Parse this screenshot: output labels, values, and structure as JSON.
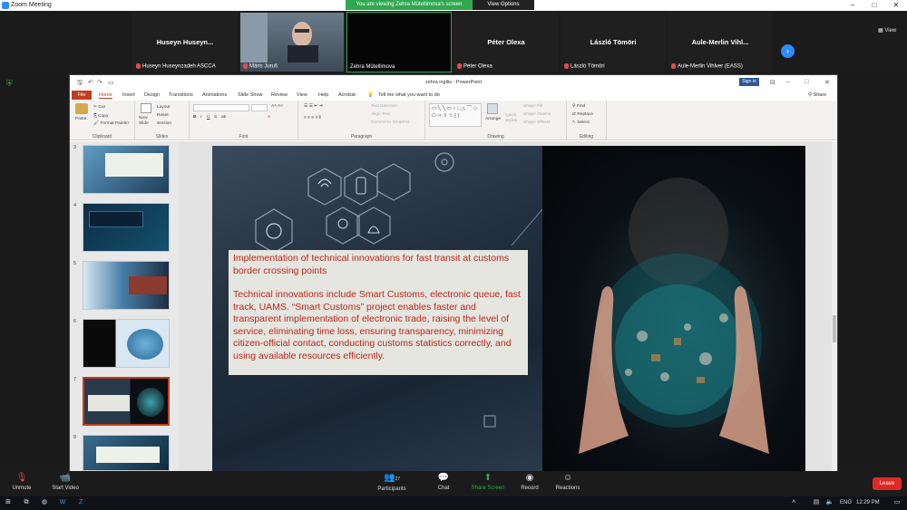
{
  "window": {
    "app_title": "Zoom Meeting"
  },
  "share_banner": {
    "viewing": "You are viewing Zehra Mütellimova's screen",
    "view_options": "View Options"
  },
  "gallery": {
    "view_label": "View",
    "tiles": [
      {
        "big": "Huseyn  Huseyn...",
        "name": "Huseyn Huseynzadeh ASCCA"
      },
      {
        "big": "",
        "name": "Märis Juruš"
      },
      {
        "big": "",
        "name": "Zehra Mütellimova"
      },
      {
        "big": "Péter Olexa",
        "name": "Péter Olexa"
      },
      {
        "big": "László Tömöri",
        "name": "László Tömöri"
      },
      {
        "big": "Aule-Merlin  Vihl...",
        "name": "Aule-Merlin Vihlver (EASS)"
      }
    ]
  },
  "powerpoint": {
    "title": "zehra ingilis  -  PowerPoint",
    "sign_in": "Sign in",
    "share": "Share",
    "tell_me": "Tell me what you want to do",
    "tabs": [
      "File",
      "Home",
      "Insert",
      "Design",
      "Transitions",
      "Animations",
      "Slide Show",
      "Review",
      "View",
      "Help",
      "Acrobat"
    ],
    "ribbon": {
      "clipboard": {
        "label": "Clipboard",
        "paste": "Paste",
        "cut": "Cut",
        "copy": "Copy",
        "format_painter": "Format Painter"
      },
      "slides": {
        "label": "Slides",
        "new_slide": "New Slide",
        "layout": "Layout",
        "reset": "Reset",
        "section": "Section"
      },
      "font": {
        "label": "Font"
      },
      "paragraph": {
        "label": "Paragraph",
        "text_direction": "Text Direction",
        "align_text": "Align Text",
        "convert_smartart": "Convert to SmartArt"
      },
      "drawing": {
        "label": "Drawing",
        "arrange": "Arrange",
        "quick_styles": "Quick Styles",
        "shape_fill": "Shape Fill",
        "shape_outline": "Shape Outline",
        "shape_effects": "Shape Effects"
      },
      "editing": {
        "label": "Editing",
        "find": "Find",
        "replace": "Replace",
        "select": "Select"
      }
    },
    "thumbnails": [
      {
        "num": "3"
      },
      {
        "num": "4"
      },
      {
        "num": "5"
      },
      {
        "num": "6"
      },
      {
        "num": "7",
        "selected": true
      },
      {
        "num": "8"
      }
    ],
    "slide": {
      "heading": "Implementation of technical innovations for fast transit at customs border crossing points",
      "body": "Technical innovations include Smart Customs, electronic queue, fast track, UAMS. “Smart Customs” project enables faster and transparent implementation of electronic trade, raising the level of service, eliminating time loss, ensuring transparency, minimizing citizen-official contact, conducting customs statistics correctly, and using available resources efficiently."
    }
  },
  "controls": {
    "unmute": "Unmute",
    "start_video": "Start Video",
    "participants": "Participants",
    "participants_count": "27",
    "chat": "Chat",
    "share_screen": "Share Screen",
    "record": "Record",
    "reactions": "Reactions",
    "leave": "Leave"
  },
  "taskbar": {
    "lang": "ENG",
    "time": "12:29 PM"
  },
  "colors": {
    "share_green": "#2fa84f",
    "zoom_blue": "#2d8cff",
    "ppt_red": "#c43e1c",
    "leave_red": "#e02828",
    "slide_text": "#c0261d"
  }
}
